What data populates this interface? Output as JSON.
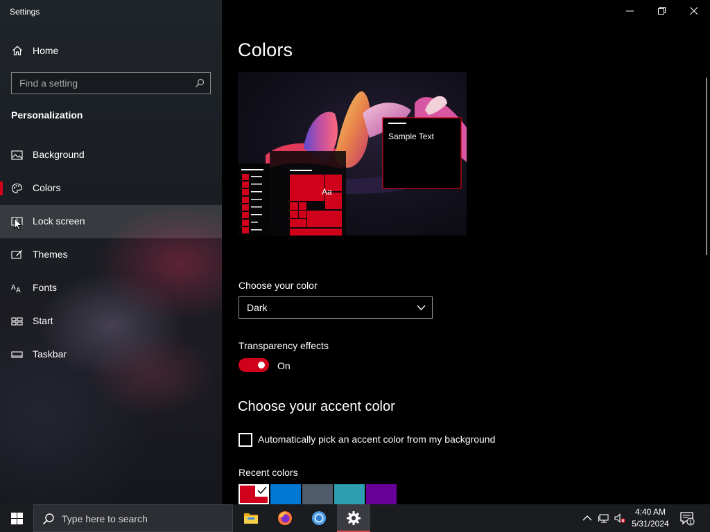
{
  "window": {
    "title": "Settings",
    "controls": [
      "minimize-icon",
      "restore-icon",
      "close-icon"
    ]
  },
  "sidebar": {
    "home_label": "Home",
    "search_placeholder": "Find a setting",
    "section_heading": "Personalization",
    "items": [
      {
        "label": "Background",
        "icon": "picture-icon"
      },
      {
        "label": "Colors",
        "icon": "palette-icon",
        "selected": true
      },
      {
        "label": "Lock screen",
        "icon": "lock-screen-icon",
        "hovered": true
      },
      {
        "label": "Themes",
        "icon": "brush-icon"
      },
      {
        "label": "Fonts",
        "icon": "fonts-icon"
      },
      {
        "label": "Start",
        "icon": "start-icon"
      },
      {
        "label": "Taskbar",
        "icon": "taskbar-icon"
      }
    ]
  },
  "content": {
    "title": "Colors",
    "preview": {
      "sample_text": "Sample Text",
      "tile_text": "Aa",
      "accent": "#d0021b"
    },
    "choose_color_label": "Choose your color",
    "choose_color_value": "Dark",
    "transparency_label": "Transparency effects",
    "transparency_state": "On",
    "accent_heading": "Choose your accent color",
    "auto_pick_label": "Automatically pick an accent color from my background",
    "auto_pick_checked": false,
    "recent_colors_label": "Recent colors",
    "recent_colors": [
      "#d0021b",
      "#0078d4",
      "#515c6b",
      "#2d9fb0",
      "#68009a"
    ],
    "selected_recent_index": 0
  },
  "taskbar": {
    "search_placeholder": "Type here to search",
    "apps": [
      {
        "name": "file-explorer-icon",
        "color": "#f2c33a"
      },
      {
        "name": "firefox-icon",
        "color": "#ff7139"
      },
      {
        "name": "chrome-icon",
        "color": "#2f8fdf"
      },
      {
        "name": "settings-icon",
        "color": "#ffffff",
        "active": true
      }
    ],
    "time": "4:40 AM",
    "date": "5/31/2024",
    "notification_count": "1"
  },
  "colors": {
    "accent": "#d0021b",
    "background": "#000000",
    "taskbar": "#1a1c20"
  }
}
